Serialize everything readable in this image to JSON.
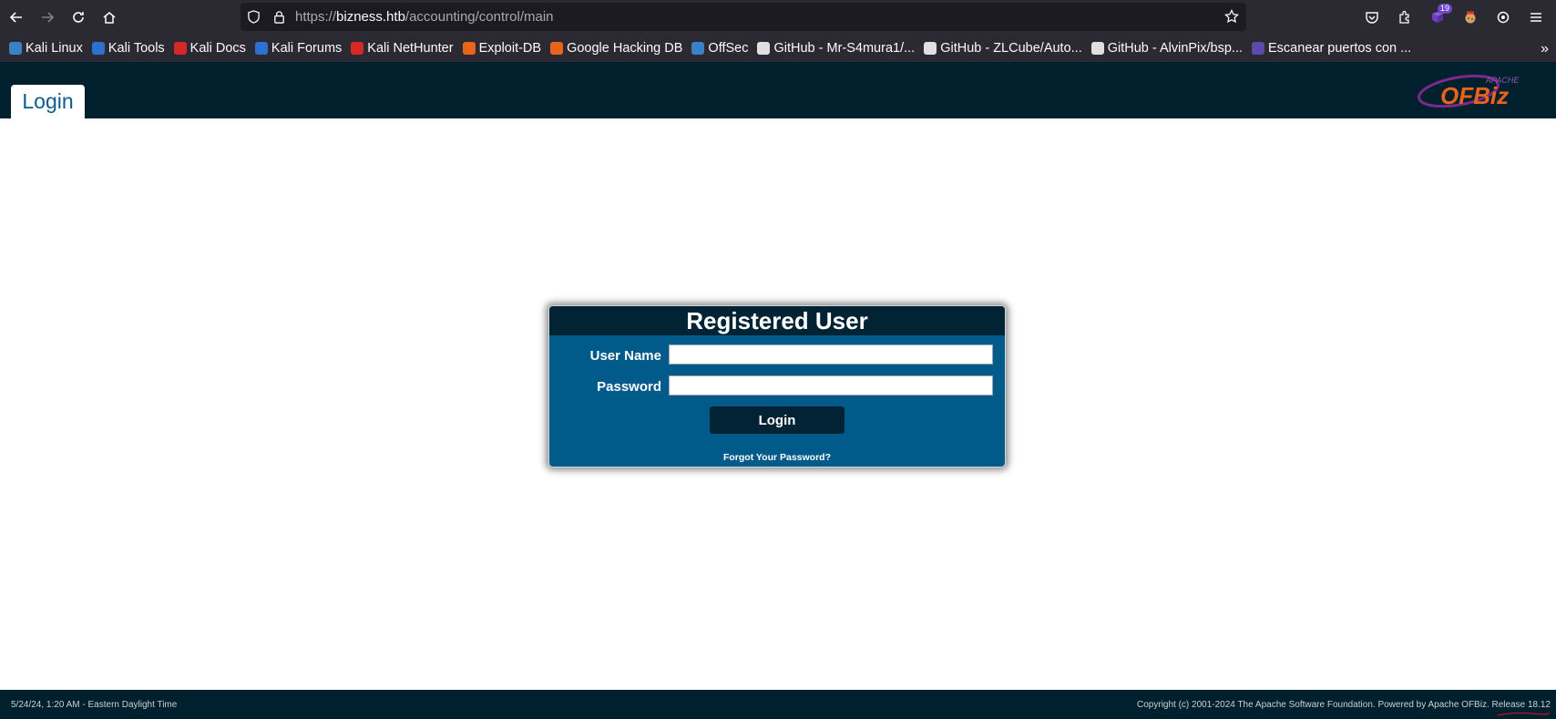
{
  "browser": {
    "url_scheme": "https://",
    "url_host": "bizness.htb",
    "url_path": "/accounting/control/main",
    "extension_badge": "19",
    "bookmarks": [
      {
        "label": "Kali Linux",
        "color": "#3b82c4"
      },
      {
        "label": "Kali Tools",
        "color": "#2f6fd0"
      },
      {
        "label": "Kali Docs",
        "color": "#d62828"
      },
      {
        "label": "Kali Forums",
        "color": "#2f6fd0"
      },
      {
        "label": "Kali NetHunter",
        "color": "#d62828"
      },
      {
        "label": "Exploit-DB",
        "color": "#e8641b"
      },
      {
        "label": "Google Hacking DB",
        "color": "#e8641b"
      },
      {
        "label": "OffSec",
        "color": "#3b82c4"
      },
      {
        "label": "GitHub - Mr-S4mura1/...",
        "color": "#e0e0e0"
      },
      {
        "label": "GitHub - ZLCube/Auto...",
        "color": "#e0e0e0"
      },
      {
        "label": "GitHub - AlvinPix/bsp...",
        "color": "#e0e0e0"
      },
      {
        "label": "Escanear puertos con ...",
        "color": "#5b4aa8"
      }
    ]
  },
  "app": {
    "tab_label": "Login",
    "logo_small": "APACHE",
    "logo_text": "OFBiz"
  },
  "login": {
    "title": "Registered User",
    "username_label": "User Name",
    "username_value": "",
    "password_label": "Password",
    "password_value": "",
    "button_label": "Login",
    "forgot_link": "Forgot Your Password?"
  },
  "footer": {
    "left": "5/24/24, 1:20 AM - Eastern Daylight Time",
    "right": "Copyright (c) 2001-2024 The Apache Software Foundation. Powered by Apache OFBiz. Release 18.12"
  }
}
